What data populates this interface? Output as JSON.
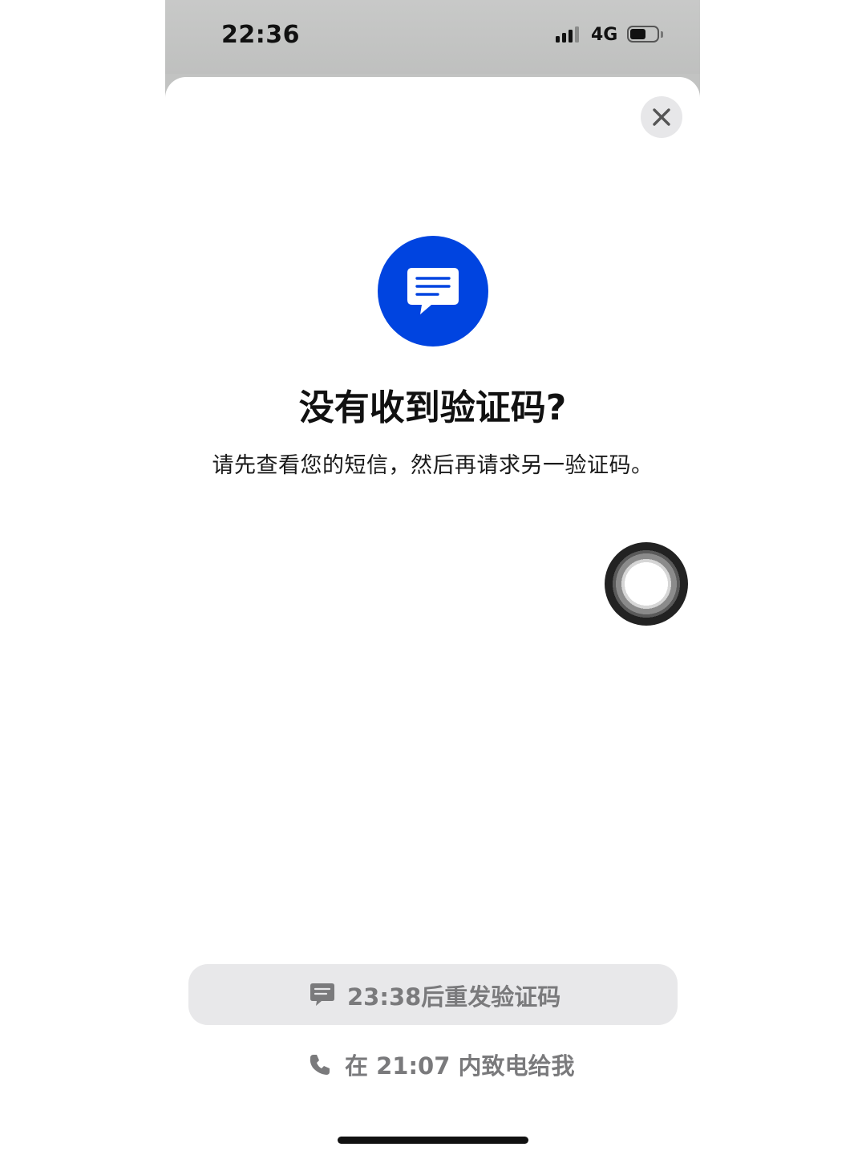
{
  "status_bar": {
    "time": "22:36",
    "network": "4G",
    "signal_bars_active": 3,
    "signal_bars_total": 4,
    "battery_level": 0.6,
    "icons": [
      "signal-icon",
      "battery-icon"
    ]
  },
  "sheet": {
    "close_icon": "close-icon",
    "badge_icon": "message-bubble-icon",
    "title": "没有收到验证码?",
    "subtitle": "请先查看您的短信，然后再请求另一验证码。"
  },
  "actions": {
    "resend_label": "23:38后重发验证码",
    "resend_icon": "message-bubble-icon",
    "call_label": "在 21:07 内致电给我",
    "call_icon": "phone-icon"
  },
  "colors": {
    "accent": "#0044e0",
    "disabled_text": "#7a7a7c",
    "button_bg": "#e8e8ea"
  }
}
